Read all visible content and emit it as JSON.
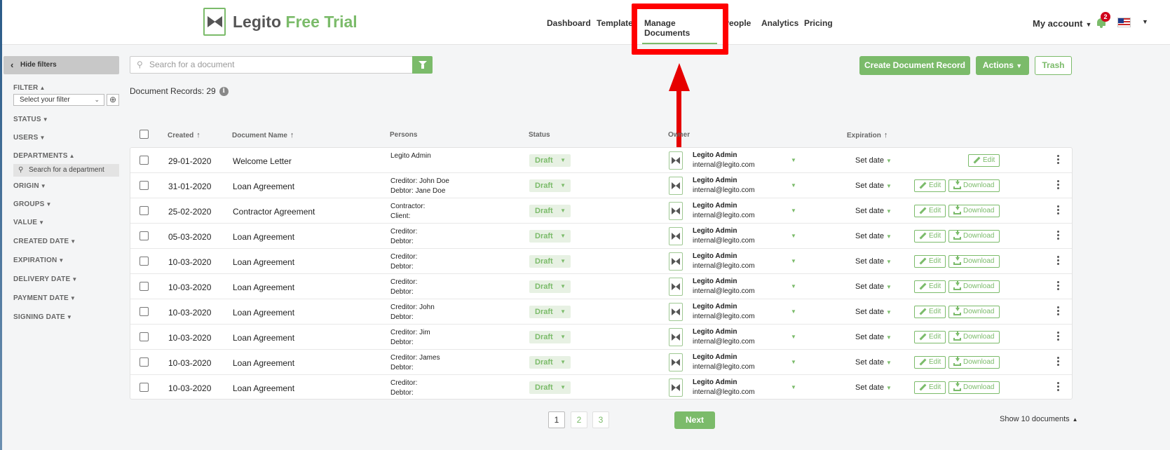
{
  "brand": {
    "name": "Legito",
    "suffix": "Free Trial"
  },
  "nav": [
    "Dashboard",
    "Templates",
    "Manage Documents",
    "People",
    "Analytics",
    "Pricing"
  ],
  "header": {
    "account": "My account",
    "notifications": "2"
  },
  "sidebar": {
    "hide_filters": "Hide filters",
    "filter": "FILTER",
    "filter_select": "Select your filter",
    "status": "STATUS",
    "users": "USERS",
    "departments": "DEPARTMENTS",
    "dept_search_placeholder": "Search for a department",
    "origin": "ORIGIN",
    "groups": "GROUPS",
    "value": "VALUE",
    "created_date": "CREATED DATE",
    "expiration": "EXPIRATION",
    "delivery_date": "DELIVERY DATE",
    "payment_date": "PAYMENT DATE",
    "signing_date": "SIGNING DATE"
  },
  "toolbar": {
    "search_placeholder": "Search for a document",
    "create": "Create Document Record",
    "actions": "Actions",
    "trash": "Trash",
    "doc_count": "Document Records: 29"
  },
  "columns": {
    "created": "Created",
    "name": "Document Name",
    "persons": "Persons",
    "status": "Status",
    "owner": "Owner",
    "expiration": "Expiration"
  },
  "rows": [
    {
      "created": "29-01-2020",
      "name": "Welcome Letter",
      "p1": "Legito Admin",
      "p2": "",
      "status": "Draft",
      "owner": "Legito Admin",
      "email": "internal@legito.com",
      "exp": "Set date",
      "edit": "Edit",
      "download": ""
    },
    {
      "created": "31-01-2020",
      "name": "Loan Agreement",
      "p1": "Creditor: John Doe",
      "p2": "Debtor: Jane Doe",
      "status": "Draft",
      "owner": "Legito Admin",
      "email": "internal@legito.com",
      "exp": "Set date",
      "edit": "Edit",
      "download": "Download"
    },
    {
      "created": "25-02-2020",
      "name": "Contractor Agreement",
      "p1": "Contractor:",
      "p2": "Client:",
      "status": "Draft",
      "owner": "Legito Admin",
      "email": "internal@legito.com",
      "exp": "Set date",
      "edit": "Edit",
      "download": "Download"
    },
    {
      "created": "05-03-2020",
      "name": "Loan Agreement",
      "p1": "Creditor:",
      "p2": "Debtor:",
      "status": "Draft",
      "owner": "Legito Admin",
      "email": "internal@legito.com",
      "exp": "Set date",
      "edit": "Edit",
      "download": "Download"
    },
    {
      "created": "10-03-2020",
      "name": "Loan Agreement",
      "p1": "Creditor:",
      "p2": "Debtor:",
      "status": "Draft",
      "owner": "Legito Admin",
      "email": "internal@legito.com",
      "exp": "Set date",
      "edit": "Edit",
      "download": "Download"
    },
    {
      "created": "10-03-2020",
      "name": "Loan Agreement",
      "p1": "Creditor:",
      "p2": "Debtor:",
      "status": "Draft",
      "owner": "Legito Admin",
      "email": "internal@legito.com",
      "exp": "Set date",
      "edit": "Edit",
      "download": "Download"
    },
    {
      "created": "10-03-2020",
      "name": "Loan Agreement",
      "p1": "Creditor: John",
      "p2": "Debtor:",
      "status": "Draft",
      "owner": "Legito Admin",
      "email": "internal@legito.com",
      "exp": "Set date",
      "edit": "Edit",
      "download": "Download"
    },
    {
      "created": "10-03-2020",
      "name": "Loan Agreement",
      "p1": "Creditor: Jim",
      "p2": "Debtor:",
      "status": "Draft",
      "owner": "Legito Admin",
      "email": "internal@legito.com",
      "exp": "Set date",
      "edit": "Edit",
      "download": "Download"
    },
    {
      "created": "10-03-2020",
      "name": "Loan Agreement",
      "p1": "Creditor: James",
      "p2": "Debtor:",
      "status": "Draft",
      "owner": "Legito Admin",
      "email": "internal@legito.com",
      "exp": "Set date",
      "edit": "Edit",
      "download": "Download"
    },
    {
      "created": "10-03-2020",
      "name": "Loan Agreement",
      "p1": "Creditor:",
      "p2": "Debtor:",
      "status": "Draft",
      "owner": "Legito Admin",
      "email": "internal@legito.com",
      "exp": "Set date",
      "edit": "Edit",
      "download": "Download"
    }
  ],
  "pagination": {
    "pages": [
      "1",
      "2",
      "3"
    ],
    "next": "Next",
    "show": "Show 10 documents"
  },
  "colors": {
    "accent": "#7bbb6a",
    "highlight": "#ff0000"
  }
}
